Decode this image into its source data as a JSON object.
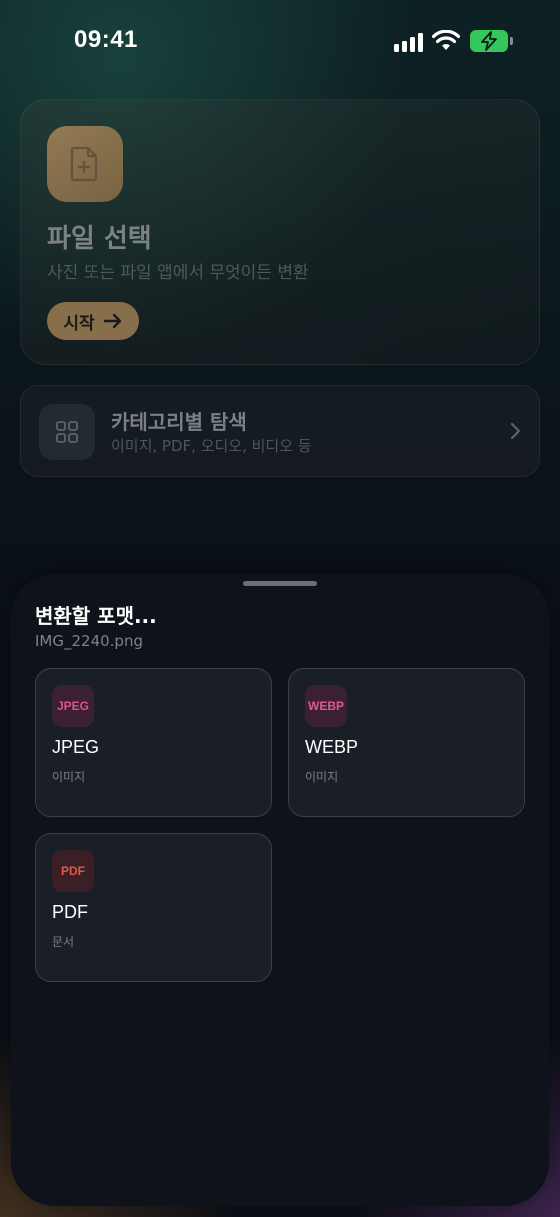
{
  "status_bar": {
    "time": "09:41",
    "icons": [
      "cellular-signal-icon",
      "wifi-icon",
      "battery-charging-icon"
    ],
    "battery_color": "#34c759"
  },
  "hero": {
    "icon": "file-plus-icon",
    "title": "파일 선택",
    "subtitle": "사진 또는 파일 앱에서 무엇이든 변환",
    "start_label": "시작",
    "accent": "#9c7e52"
  },
  "category": {
    "icon": "grid-icon",
    "title": "카테고리별 탐색",
    "subtitle": "이미지, PDF, 오디오, 비디오 등"
  },
  "sheet": {
    "title": "변환할 포맷...",
    "filename": "IMG_2240.png",
    "formats": [
      {
        "badge": "JPEG",
        "name": "JPEG",
        "type": "이미지",
        "badge_color": "#e0538a",
        "badge_bg": "#3a2030"
      },
      {
        "badge": "WEBP",
        "name": "WEBP",
        "type": "이미지",
        "badge_color": "#e05a8c",
        "badge_bg": "#3a2030"
      },
      {
        "badge": "PDF",
        "name": "PDF",
        "type": "문서",
        "badge_color": "#e0574a",
        "badge_bg": "#3a2026"
      }
    ]
  }
}
